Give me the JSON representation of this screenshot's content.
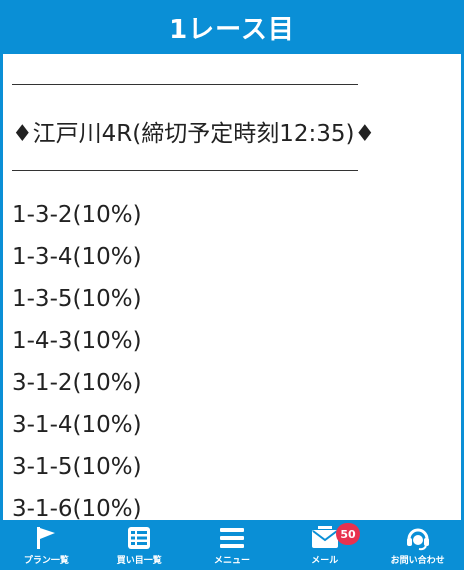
{
  "header": {
    "title": "1レース目"
  },
  "content": {
    "race_line": "♦江戸川4R(締切予定時刻12:35)♦",
    "picks": [
      "1-3-2(10%)",
      "1-3-4(10%)",
      "1-3-5(10%)",
      "1-4-3(10%)",
      "3-1-2(10%)",
      "3-1-4(10%)",
      "3-1-5(10%)",
      "3-1-6(10%)"
    ]
  },
  "bottom_nav": {
    "items": [
      {
        "label": "プラン一覧",
        "icon": "flag-icon"
      },
      {
        "label": "買い目一覧",
        "icon": "list-icon"
      },
      {
        "label": "メニュー",
        "icon": "hamburger-menu-icon"
      },
      {
        "label": "メール",
        "icon": "mail-icon",
        "badge": "50"
      },
      {
        "label": "お問い合わせ",
        "icon": "headset-icon"
      }
    ]
  },
  "colors": {
    "brand_blue": "#0a8fd6",
    "badge_red": "#e8324f",
    "text": "#222222"
  }
}
